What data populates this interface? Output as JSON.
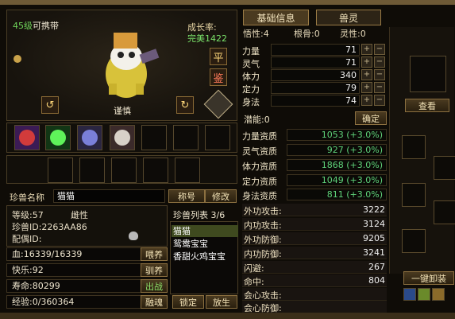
{
  "tabs": {
    "basic": "基础信息",
    "spirit": "兽灵"
  },
  "header": {
    "understanding": "悟性:4",
    "bone": "根骨:0",
    "spirituality": "灵性:0"
  },
  "preview": {
    "level": "45级",
    "carry": "可携带",
    "growth_label": "成长率:",
    "growth_value": "完美1422",
    "ping_btn": "平",
    "jian_btn": "鉴",
    "temper": "谨慎"
  },
  "name_row": {
    "label": "珍兽名称",
    "value": "猫猫",
    "title_btn": "称号",
    "rename_btn": "修改"
  },
  "info": {
    "level": "等级:57",
    "gender": "雌性",
    "id": "珍兽ID:2263AA86",
    "mate": "配偶ID:"
  },
  "stats": [
    {
      "text": "血:16339/16339",
      "btn": "喂养"
    },
    {
      "text": "快乐:92",
      "btn": "驯养"
    },
    {
      "text": "寿命:80299",
      "btn": "出战"
    },
    {
      "text": "经验:0/360364",
      "btn": "融魂"
    }
  ],
  "pet_list": {
    "header": "珍兽列表 3/6",
    "items": [
      "猫猫",
      "鸳鸯宝宝",
      "香甜火鸡宝宝"
    ],
    "lock_btn": "锁定",
    "release_btn": "放生"
  },
  "attributes": [
    {
      "label": "力量",
      "value": "71"
    },
    {
      "label": "灵气",
      "value": "71"
    },
    {
      "label": "体力",
      "value": "340"
    },
    {
      "label": "定力",
      "value": "79"
    },
    {
      "label": "身法",
      "value": "74"
    }
  ],
  "potential": "潜能:0",
  "confirm_btn": "确定",
  "aptitudes": [
    {
      "label": "力量资质",
      "value": "1053 (+3.0%)"
    },
    {
      "label": "灵气资质",
      "value": "927 (+3.0%)"
    },
    {
      "label": "体力资质",
      "value": "1868 (+3.0%)"
    },
    {
      "label": "定力资质",
      "value": "1049 (+3.0%)"
    },
    {
      "label": "身法资质",
      "value": "811 (+3.0%)"
    }
  ],
  "combat": [
    {
      "label": "外功攻击:",
      "value": "3222"
    },
    {
      "label": "内功攻击:",
      "value": "3124"
    },
    {
      "label": "外功防御:",
      "value": "9205"
    },
    {
      "label": "内功防御:",
      "value": "3241"
    },
    {
      "label": "闪避:",
      "value": "267"
    },
    {
      "label": "命中:",
      "value": "804"
    },
    {
      "label": "会心攻击:",
      "value": ""
    },
    {
      "label": "会心防御:",
      "value": ""
    }
  ],
  "view_btn": "查看",
  "unequip_btn": "一键卸装"
}
